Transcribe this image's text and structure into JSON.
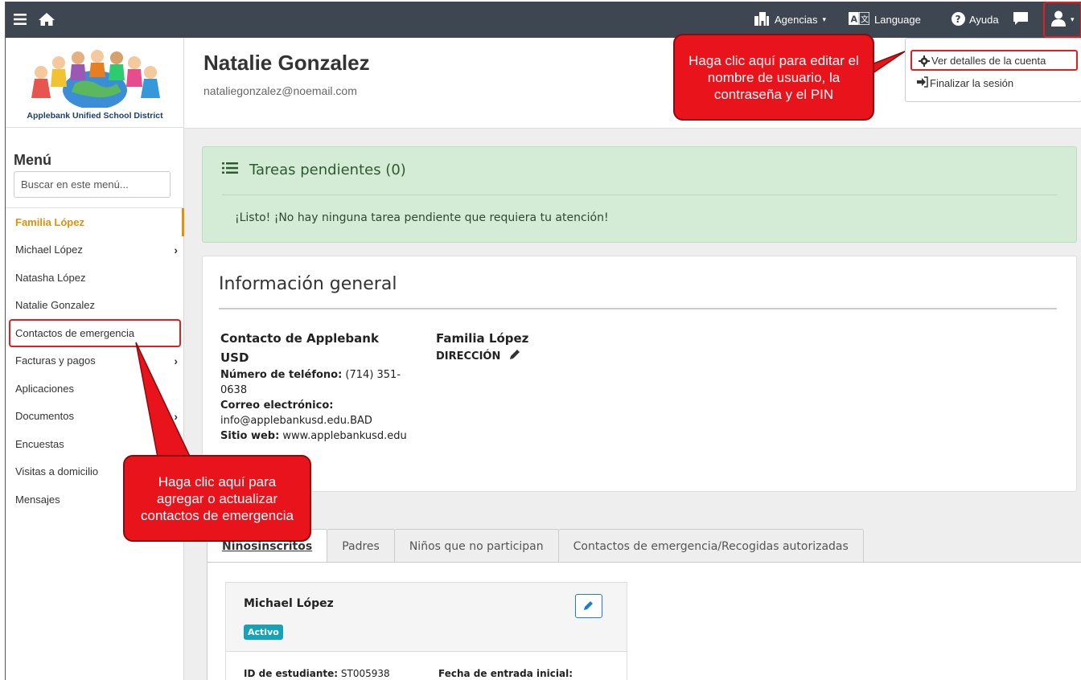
{
  "topbar": {
    "agencies_label": "Agencias",
    "language_label": "Language",
    "help_label": "Ayuda"
  },
  "sidebar": {
    "logo_text": "Applebank Unified School District",
    "menu_title": "Menú",
    "search_placeholder": "Buscar en este menú...",
    "items": [
      {
        "label": "Familia López"
      },
      {
        "label": "Michael López"
      },
      {
        "label": "Natasha López"
      },
      {
        "label": "Natalie Gonzalez"
      },
      {
        "label": "Contactos de emergencia"
      },
      {
        "label": "Facturas y pagos"
      },
      {
        "label": "Aplicaciones"
      },
      {
        "label": "Documentos"
      },
      {
        "label": "Encuestas"
      },
      {
        "label": "Visitas a domicilio"
      },
      {
        "label": "Mensajes"
      }
    ]
  },
  "header": {
    "name": "Natalie Gonzalez",
    "email": "nataliegonzalez@noemail.com"
  },
  "dropdown": {
    "account_details": "Ver detalles de la cuenta",
    "logout": "Finalizar la sesión"
  },
  "tasks": {
    "title": "Tareas pendientes (0)",
    "message": "¡Listo! ¡No hay ninguna tarea pendiente que requiera tu atención!"
  },
  "info": {
    "title": "Información general",
    "contact_heading_1": "Contacto de Applebank",
    "contact_heading_2": "USD",
    "phone_label": "Número de teléfono:",
    "phone_value_1": " (714) 351-",
    "phone_value_2": "0638",
    "email_label": "Correo electrónico:",
    "email_value": "info@applebankusd.edu.BAD",
    "web_label": "Sitio web:",
    "web_value": " www.applebankusd.edu",
    "family_heading": "Familia López",
    "address_label": "DIRECCIÓN"
  },
  "tabs": [
    {
      "label": "Niñosinscritos"
    },
    {
      "label": "Padres"
    },
    {
      "label": "Niños que no participan"
    },
    {
      "label": "Contactos de emergencia/Recogidas autorizadas"
    }
  ],
  "child": {
    "name": "Michael López",
    "status": "Activo",
    "student_id_label": "ID de estudiante:",
    "student_id_value": " ST005938",
    "entry_date_label": "Fecha de entrada inicial:"
  },
  "callouts": {
    "account": "Haga clic aquí para editar el nombre de usuario, la contraseña y el PIN",
    "emergency": "Haga clic aquí para agregar o actualizar contactos de emergencia"
  },
  "colors": {
    "navbar": "#3e4651",
    "accent_orange": "#e0900c",
    "success_bg": "#d4ebd6",
    "callout_red": "#e8131b",
    "badge_teal": "#17a2b8"
  }
}
